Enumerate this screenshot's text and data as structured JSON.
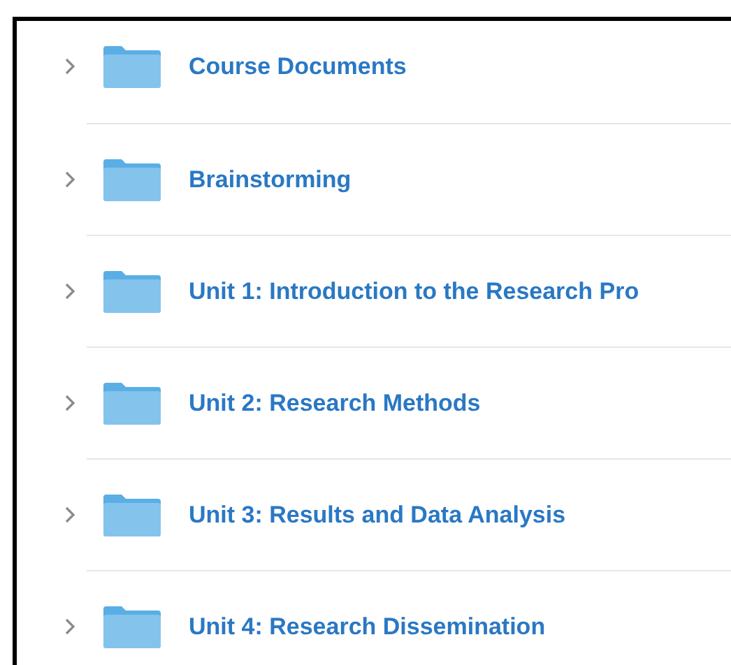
{
  "folders": [
    {
      "name": "Course Documents",
      "expanded": false
    },
    {
      "name": "Brainstorming",
      "expanded": false
    },
    {
      "name": "Unit 1: Introduction to the Research Pro",
      "expanded": false
    },
    {
      "name": "Unit 2: Research Methods",
      "expanded": false
    },
    {
      "name": "Unit 3: Results and Data Analysis",
      "expanded": false
    },
    {
      "name": "Unit 4: Research Dissemination",
      "expanded": false
    }
  ]
}
